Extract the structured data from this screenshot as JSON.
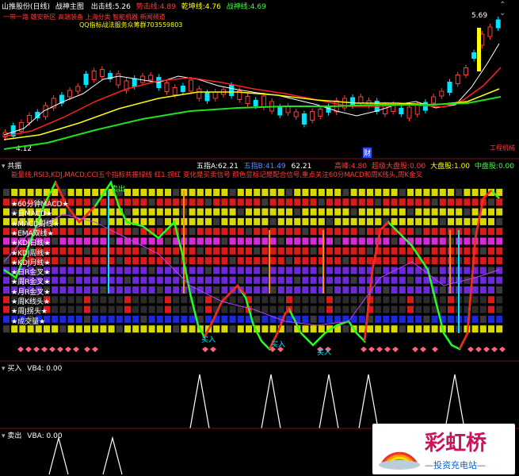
{
  "main": {
    "stock": "山推股份(日线)",
    "indicator": "战神主图",
    "exit_label": "出击线:",
    "exit_val": "5.26",
    "bull_label": "势击线:",
    "bull_val": "4.89",
    "qian_label": "乾坤线:",
    "qian_val": "4.76",
    "war_label": "战神线:",
    "war_val": "4.69",
    "banner1": "一带一路 雄安新区 高端装备 上海分类 智能机器 新闻频道",
    "banner2": "QQ指标战法服务众筹群703559803",
    "high": "5.69",
    "low": "4.12",
    "note": "财",
    "note2": "工程机械"
  },
  "mid": {
    "title": "共振",
    "wuzhi_label": "五指A:",
    "wuzhi_val": "62.21",
    "wuzhi2_label": "五指B:",
    "wuzhi2_val": "41.49",
    "wuzhi3_val": "62.21",
    "rise_label": "高峰:",
    "rise_val": "4.80",
    "super_label": "超级大盘股:",
    "super_val": "0.00",
    "big_label": "大盘股:",
    "big_val": "1.00",
    "mid_label": "中盘股:",
    "mid_val": "0.00",
    "desc": "能量线,RSI3,KDJ,MACD,CCI五个指标共振绿线 红1.拐红 变化是买卖信号 颜色显标记是配合信号,重点关注60分MACD和周K线头,周K金叉",
    "sell_tag": "卖出",
    "buy_tag": "买入",
    "rows": [
      "★60分钟MACD★",
      "★日MACD★",
      "★MACD周线★",
      "★EMA双线★",
      "★KDJ日线★",
      "★KDJ周线★",
      "★KDJ月线★",
      "★日R金叉★",
      "★周R金叉★",
      "★月R金叉★",
      "★周K线头★",
      "★周J拐头★",
      "★成交量★"
    ]
  },
  "buy_pane": {
    "title": "买入",
    "label": "VB4:",
    "val": "0.00"
  },
  "sell_pane": {
    "title": "卖出",
    "label": "VBA:",
    "val": "0.00"
  },
  "logo": {
    "name": "彩虹桥",
    "sub": "—投资充电站—"
  }
}
